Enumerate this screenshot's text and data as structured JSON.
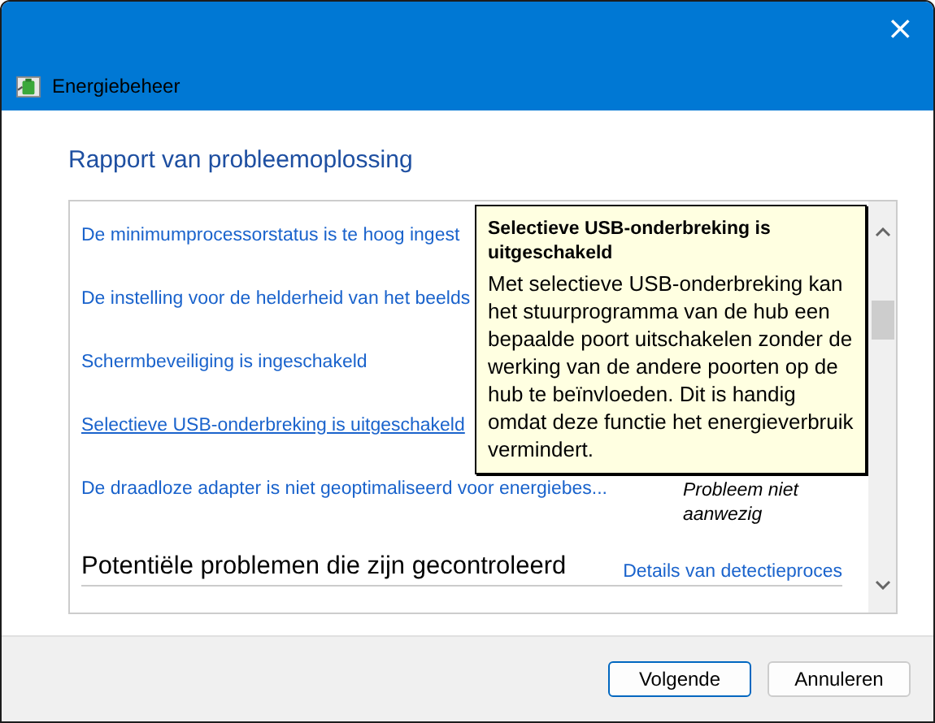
{
  "window": {
    "title": "Energiebeheer",
    "close": "×"
  },
  "heading": "Rapport van probleemoplossing",
  "issues": [
    {
      "label": "De minimumprocessorstatus is te hoog ingest",
      "hovered": false
    },
    {
      "label": "De instelling voor de helderheid van het beelds",
      "hovered": false
    },
    {
      "label": "Schermbeveiliging is ingeschakeld",
      "hovered": false
    },
    {
      "label": "Selectieve USB-onderbreking is uitgeschakeld",
      "hovered": true
    },
    {
      "label": "De draadloze adapter is niet geoptimaliseerd voor energiebes...",
      "hovered": false,
      "status": "Probleem niet aanwezig"
    }
  ],
  "section": {
    "title": "Potentiële problemen die zijn gecontroleerd",
    "link": "Details van detectieproces"
  },
  "tooltip": {
    "title": "Selectieve USB-onderbreking is uitgeschakeld",
    "text": "Met selectieve USB-onderbreking kan het stuurprogramma van de hub een bepaalde poort uitschakelen zonder de werking van de andere poorten op de hub te beïnvloeden. Dit is handig omdat deze functie het energieverbruik vermindert."
  },
  "buttons": [
    {
      "label": "Volgende",
      "default": true
    },
    {
      "label": "Annuleren",
      "default": false
    }
  ]
}
